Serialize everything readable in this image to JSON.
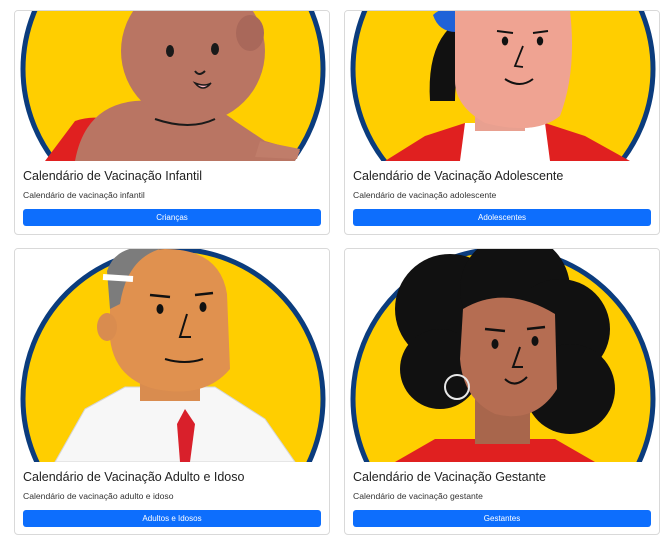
{
  "cards": [
    {
      "title": "Calendário de Vacinação Infantil",
      "text": "Calendário de vacinação infantil",
      "button": "Crianças"
    },
    {
      "title": "Calendário de Vacinação Adolescente",
      "text": "Calendário de vacinação adolescente",
      "button": "Adolescentes"
    },
    {
      "title": "Calendário de Vacinação Adulto e Idoso",
      "text": "Calendário de vacinação adulto e idoso",
      "button": "Adultos e Idosos"
    },
    {
      "title": "Calendário de Vacinação Gestante",
      "text": "Calendário de vacinação gestante",
      "button": "Gestantes"
    }
  ],
  "colors": {
    "button": "#0d6efd",
    "circle_fill": "#ffce00",
    "circle_border": "#0b3c7d"
  }
}
